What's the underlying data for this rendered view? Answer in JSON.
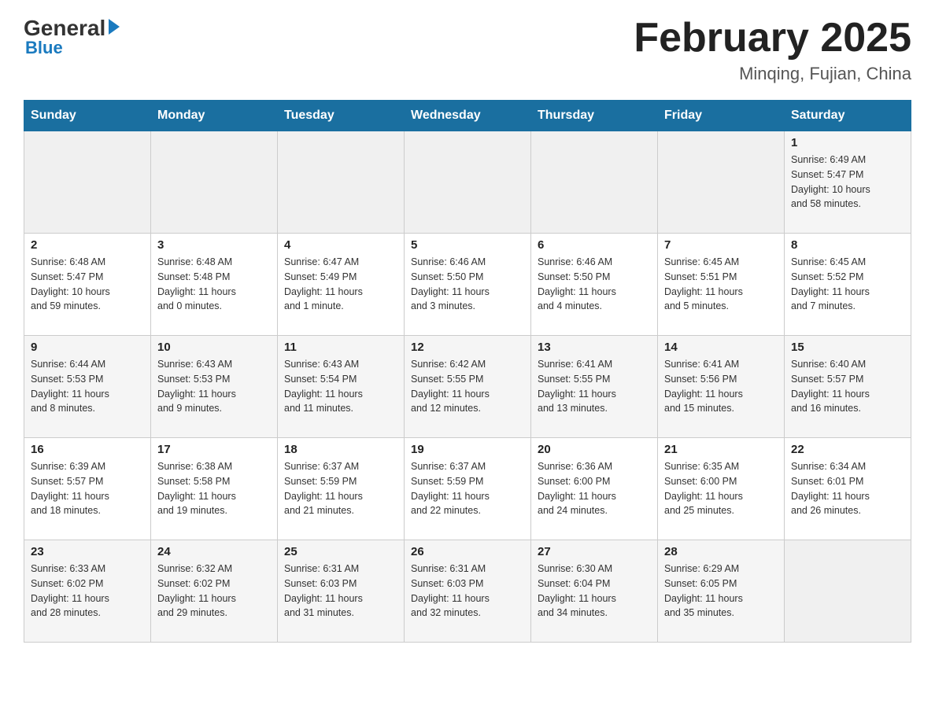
{
  "header": {
    "logo": {
      "general": "General",
      "blue": "Blue"
    },
    "title": "February 2025",
    "location": "Minqing, Fujian, China"
  },
  "calendar": {
    "weekdays": [
      "Sunday",
      "Monday",
      "Tuesday",
      "Wednesday",
      "Thursday",
      "Friday",
      "Saturday"
    ],
    "rows": [
      {
        "days": [
          {
            "number": "",
            "info": ""
          },
          {
            "number": "",
            "info": ""
          },
          {
            "number": "",
            "info": ""
          },
          {
            "number": "",
            "info": ""
          },
          {
            "number": "",
            "info": ""
          },
          {
            "number": "",
            "info": ""
          },
          {
            "number": "1",
            "info": "Sunrise: 6:49 AM\nSunset: 5:47 PM\nDaylight: 10 hours\nand 58 minutes."
          }
        ]
      },
      {
        "days": [
          {
            "number": "2",
            "info": "Sunrise: 6:48 AM\nSunset: 5:47 PM\nDaylight: 10 hours\nand 59 minutes."
          },
          {
            "number": "3",
            "info": "Sunrise: 6:48 AM\nSunset: 5:48 PM\nDaylight: 11 hours\nand 0 minutes."
          },
          {
            "number": "4",
            "info": "Sunrise: 6:47 AM\nSunset: 5:49 PM\nDaylight: 11 hours\nand 1 minute."
          },
          {
            "number": "5",
            "info": "Sunrise: 6:46 AM\nSunset: 5:50 PM\nDaylight: 11 hours\nand 3 minutes."
          },
          {
            "number": "6",
            "info": "Sunrise: 6:46 AM\nSunset: 5:50 PM\nDaylight: 11 hours\nand 4 minutes."
          },
          {
            "number": "7",
            "info": "Sunrise: 6:45 AM\nSunset: 5:51 PM\nDaylight: 11 hours\nand 5 minutes."
          },
          {
            "number": "8",
            "info": "Sunrise: 6:45 AM\nSunset: 5:52 PM\nDaylight: 11 hours\nand 7 minutes."
          }
        ]
      },
      {
        "days": [
          {
            "number": "9",
            "info": "Sunrise: 6:44 AM\nSunset: 5:53 PM\nDaylight: 11 hours\nand 8 minutes."
          },
          {
            "number": "10",
            "info": "Sunrise: 6:43 AM\nSunset: 5:53 PM\nDaylight: 11 hours\nand 9 minutes."
          },
          {
            "number": "11",
            "info": "Sunrise: 6:43 AM\nSunset: 5:54 PM\nDaylight: 11 hours\nand 11 minutes."
          },
          {
            "number": "12",
            "info": "Sunrise: 6:42 AM\nSunset: 5:55 PM\nDaylight: 11 hours\nand 12 minutes."
          },
          {
            "number": "13",
            "info": "Sunrise: 6:41 AM\nSunset: 5:55 PM\nDaylight: 11 hours\nand 13 minutes."
          },
          {
            "number": "14",
            "info": "Sunrise: 6:41 AM\nSunset: 5:56 PM\nDaylight: 11 hours\nand 15 minutes."
          },
          {
            "number": "15",
            "info": "Sunrise: 6:40 AM\nSunset: 5:57 PM\nDaylight: 11 hours\nand 16 minutes."
          }
        ]
      },
      {
        "days": [
          {
            "number": "16",
            "info": "Sunrise: 6:39 AM\nSunset: 5:57 PM\nDaylight: 11 hours\nand 18 minutes."
          },
          {
            "number": "17",
            "info": "Sunrise: 6:38 AM\nSunset: 5:58 PM\nDaylight: 11 hours\nand 19 minutes."
          },
          {
            "number": "18",
            "info": "Sunrise: 6:37 AM\nSunset: 5:59 PM\nDaylight: 11 hours\nand 21 minutes."
          },
          {
            "number": "19",
            "info": "Sunrise: 6:37 AM\nSunset: 5:59 PM\nDaylight: 11 hours\nand 22 minutes."
          },
          {
            "number": "20",
            "info": "Sunrise: 6:36 AM\nSunset: 6:00 PM\nDaylight: 11 hours\nand 24 minutes."
          },
          {
            "number": "21",
            "info": "Sunrise: 6:35 AM\nSunset: 6:00 PM\nDaylight: 11 hours\nand 25 minutes."
          },
          {
            "number": "22",
            "info": "Sunrise: 6:34 AM\nSunset: 6:01 PM\nDaylight: 11 hours\nand 26 minutes."
          }
        ]
      },
      {
        "days": [
          {
            "number": "23",
            "info": "Sunrise: 6:33 AM\nSunset: 6:02 PM\nDaylight: 11 hours\nand 28 minutes."
          },
          {
            "number": "24",
            "info": "Sunrise: 6:32 AM\nSunset: 6:02 PM\nDaylight: 11 hours\nand 29 minutes."
          },
          {
            "number": "25",
            "info": "Sunrise: 6:31 AM\nSunset: 6:03 PM\nDaylight: 11 hours\nand 31 minutes."
          },
          {
            "number": "26",
            "info": "Sunrise: 6:31 AM\nSunset: 6:03 PM\nDaylight: 11 hours\nand 32 minutes."
          },
          {
            "number": "27",
            "info": "Sunrise: 6:30 AM\nSunset: 6:04 PM\nDaylight: 11 hours\nand 34 minutes."
          },
          {
            "number": "28",
            "info": "Sunrise: 6:29 AM\nSunset: 6:05 PM\nDaylight: 11 hours\nand 35 minutes."
          },
          {
            "number": "",
            "info": ""
          }
        ]
      }
    ]
  }
}
